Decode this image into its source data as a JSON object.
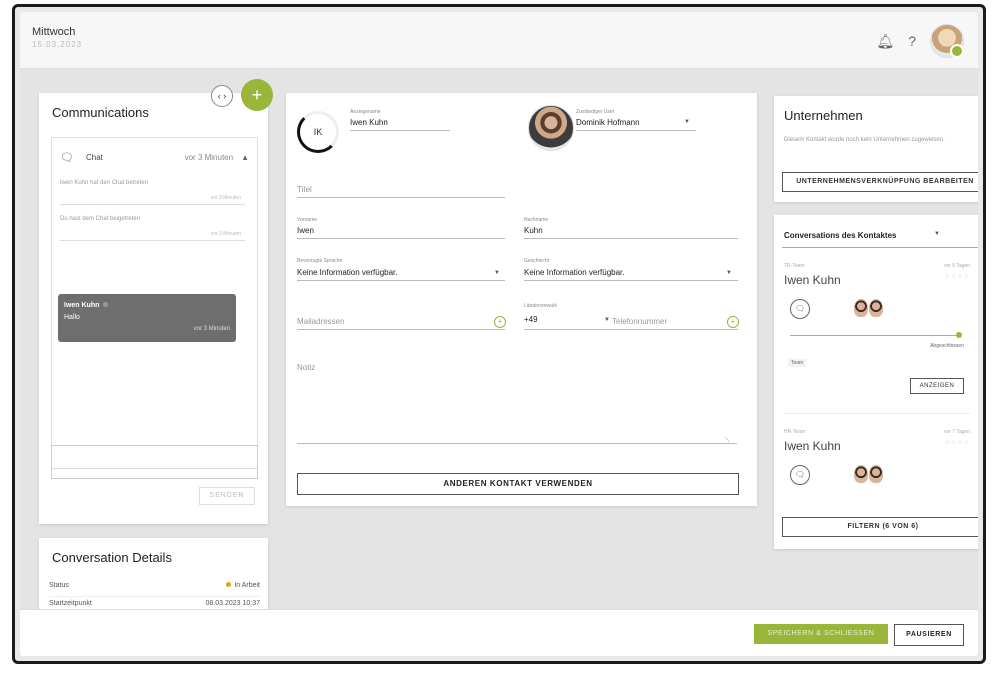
{
  "header": {
    "day": "Mittwoch",
    "date": "15.03.2023",
    "bell_icon": "bell-icon",
    "help_label": "?"
  },
  "communications": {
    "title": "Communications",
    "expand_label": "‹ ›",
    "add_label": "+",
    "chat": {
      "label": "Chat",
      "ago": "vor 3 Minuten"
    },
    "messages": [
      {
        "text": "Iwen Kuhn hat den Chat betreten",
        "time": "vor 3 Minuten"
      },
      {
        "text": "Du hast dem Chat beigetreten",
        "time": "vor 3 Minuten"
      }
    ],
    "active": {
      "name": "Iwen Kuhn",
      "message": "Hallo",
      "ago": "vor 3 Minuten"
    },
    "send_label": "SENDEN"
  },
  "details": {
    "title": "Conversation Details",
    "rows": [
      {
        "label": "Status",
        "value": "In Arbeit"
      },
      {
        "label": "Startzeitpunkt",
        "value": "08.03.2023 10:37"
      }
    ]
  },
  "contact": {
    "initials": "IK",
    "display_name_label": "Anzeigename",
    "display_name": "Iwen Kuhn",
    "owner_label": "Zuständiger User",
    "owner": "Dominik Hofmann",
    "title_placeholder": "Titel",
    "first_name_label": "Vorname",
    "first_name": "Iwen",
    "last_name_label": "Nachname",
    "last_name": "Kuhn",
    "language_label": "Bevorzugte Sprache",
    "language": "Keine Information verfügbar.",
    "gender_label": "Geschlecht",
    "gender": "Keine Information verfügbar.",
    "email_placeholder": "Mailadressen",
    "country_code_label": "Ländervorwahl",
    "country_code": "+49",
    "phone_placeholder": "Telefonnummer",
    "notes_placeholder": "Notiz",
    "other_contact_label": "ANDEREN KONTAKT VERWENDEN"
  },
  "company": {
    "title": "Unternehmen",
    "note": "Diesem Kontakt wurde noch kein Unternehmen zugewiesen.",
    "edit_label": "UNTERNEHMENSVERKNÜPFUNG BEARBEITEN"
  },
  "contact_conversations": {
    "title": "Conversations des Kontaktes",
    "items": [
      {
        "team": "TR-Team",
        "name": "Iwen Kuhn",
        "ago": "vor 5 Tagen",
        "stars": "☆☆☆☆",
        "state": "Abgeschlossen",
        "tag": "Team",
        "show_label": "ANZEIGEN"
      },
      {
        "team": "HR-Team",
        "name": "Iwen Kuhn",
        "ago": "vor 7 Tagen",
        "stars": "☆☆☆☆"
      }
    ],
    "filter_label": "FILTERN (6 VON 6)"
  },
  "footer": {
    "save_label": "SPEICHERN & SCHLIESSEN",
    "pause_label": "PAUSIEREN"
  },
  "colors": {
    "accent": "#9ab63a",
    "active_chat": "#6e6e6e"
  }
}
